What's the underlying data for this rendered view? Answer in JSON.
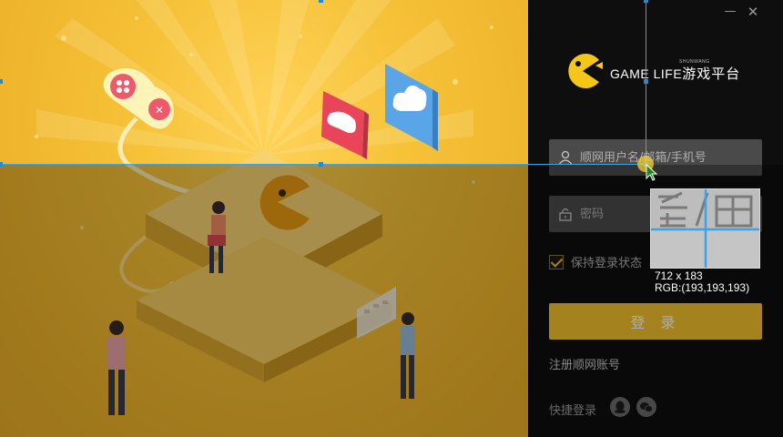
{
  "window": {
    "minimize_symbol": "—",
    "close_symbol": "✕"
  },
  "logo": {
    "brand": "GAME LIFE",
    "brand_cn": "游戏平台",
    "brand_small": "SHUNWANG"
  },
  "login": {
    "username_placeholder": "顺网用户名/邮箱/手机号",
    "password_placeholder": "密码",
    "remember_label": "保持登录状态",
    "remember_checked": true,
    "login_button": "登 录",
    "register_link": "注册顺网账号",
    "quick_login_label": "快捷登录"
  },
  "screen_capture": {
    "size_text": "712 x 183",
    "rgb_text": "RGB:(193,193,193)"
  },
  "colors": {
    "accent": "#f2c12e",
    "panel_bg": "#0e0e0e",
    "selection": "#3ba3e6"
  },
  "icons": [
    "pacman-logo-icon",
    "user-icon",
    "lock-icon",
    "checkmark-icon",
    "qq-icon",
    "wechat-icon",
    "gamepad-icon",
    "cloud-icon"
  ]
}
